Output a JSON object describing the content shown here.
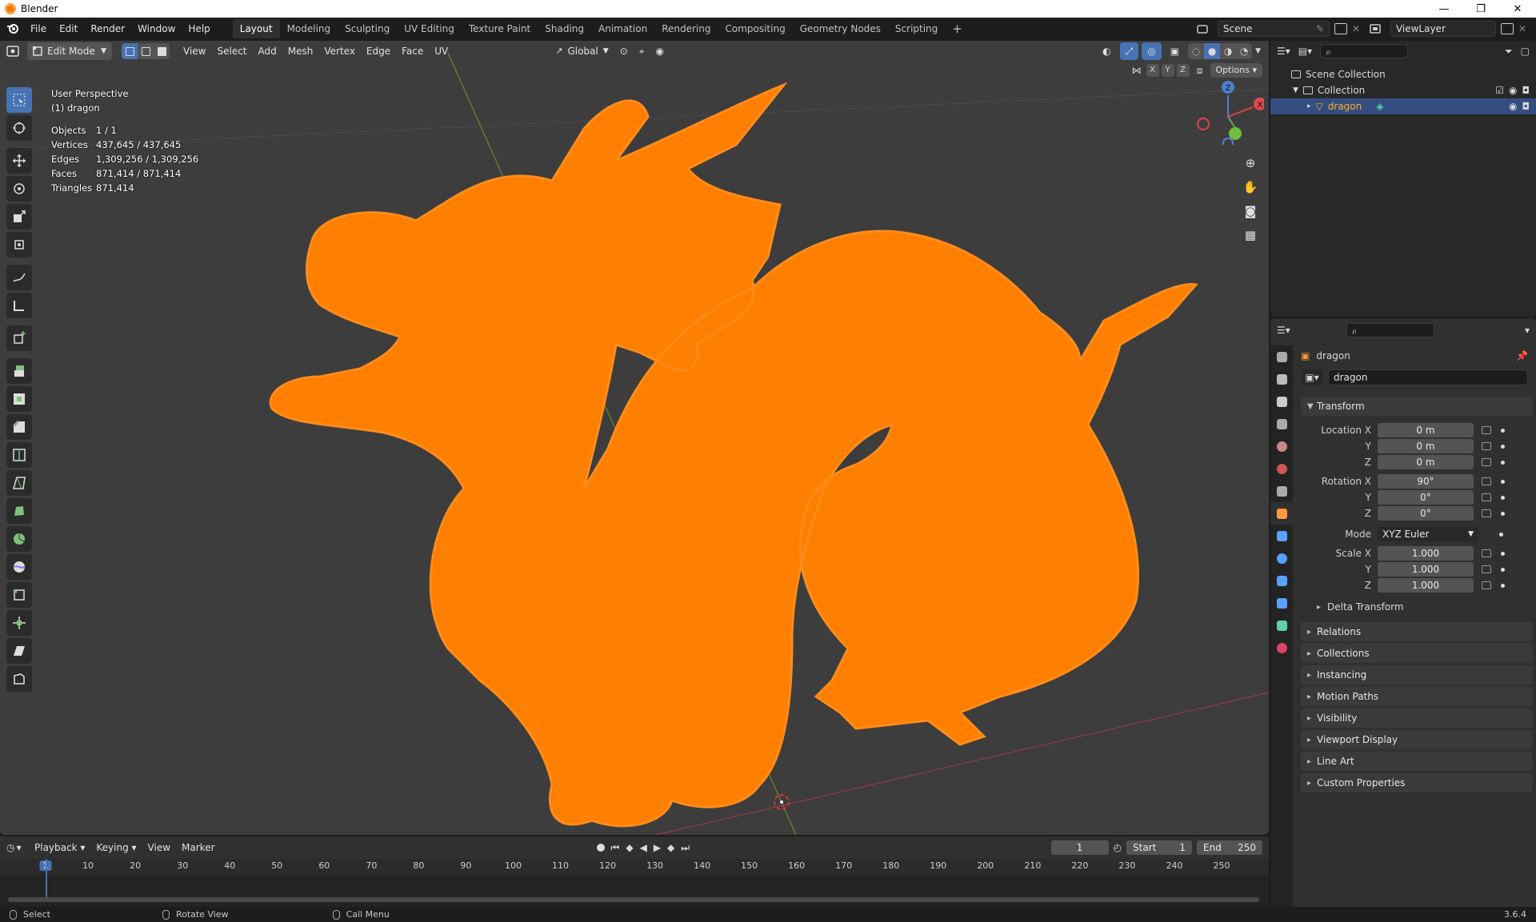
{
  "window": {
    "title": "Blender",
    "minimize": "—",
    "maximize": "❐",
    "close": "✕"
  },
  "menus": [
    "File",
    "Edit",
    "Render",
    "Window",
    "Help"
  ],
  "workspaces": [
    {
      "label": "Layout",
      "active": true
    },
    {
      "label": "Modeling"
    },
    {
      "label": "Sculpting"
    },
    {
      "label": "UV Editing"
    },
    {
      "label": "Texture Paint"
    },
    {
      "label": "Shading"
    },
    {
      "label": "Animation"
    },
    {
      "label": "Rendering"
    },
    {
      "label": "Compositing"
    },
    {
      "label": "Geometry Nodes"
    },
    {
      "label": "Scripting"
    }
  ],
  "add_workspace": "+",
  "scene": {
    "name": "Scene",
    "view_layer": "ViewLayer"
  },
  "viewport_header": {
    "mode": "Edit Mode",
    "menus": [
      "View",
      "Select",
      "Add",
      "Mesh",
      "Vertex",
      "Edge",
      "Face",
      "UV"
    ],
    "orientation": "Global",
    "axes": [
      "X",
      "Y",
      "Z"
    ],
    "options": "Options"
  },
  "overlay": {
    "view_name": "User Perspective",
    "object_label": "(1) dragon",
    "stats": [
      {
        "key": "Objects",
        "value": "1 / 1"
      },
      {
        "key": "Vertices",
        "value": "437,645 / 437,645"
      },
      {
        "key": "Edges",
        "value": "1,309,256 / 1,309,256"
      },
      {
        "key": "Faces",
        "value": "871,414 / 871,414"
      },
      {
        "key": "Triangles",
        "value": "871,414"
      }
    ]
  },
  "gizmo": {
    "z": "Z",
    "y": "Y",
    "x": "X"
  },
  "outliner": {
    "root": "Scene Collection",
    "collection": "Collection",
    "object": "dragon"
  },
  "properties": {
    "object_name": "dragon",
    "data_name": "dragon",
    "transform_title": "Transform",
    "location": [
      {
        "label": "Location X",
        "value": "0 m"
      },
      {
        "label": "Y",
        "value": "0 m"
      },
      {
        "label": "Z",
        "value": "0 m"
      }
    ],
    "rotation": [
      {
        "label": "Rotation X",
        "value": "90°"
      },
      {
        "label": "Y",
        "value": "0°"
      },
      {
        "label": "Z",
        "value": "0°"
      }
    ],
    "mode_label": "Mode",
    "mode_value": "XYZ Euler",
    "scale": [
      {
        "label": "Scale X",
        "value": "1.000"
      },
      {
        "label": "Y",
        "value": "1.000"
      },
      {
        "label": "Z",
        "value": "1.000"
      }
    ],
    "delta_transform": "Delta Transform",
    "panels": [
      "Relations",
      "Collections",
      "Instancing",
      "Motion Paths",
      "Visibility",
      "Viewport Display",
      "Line Art",
      "Custom Properties"
    ]
  },
  "timeline": {
    "menus": [
      "Playback",
      "Keying",
      "View",
      "Marker"
    ],
    "current_frame": "1",
    "start_label": "Start",
    "start": "1",
    "end_label": "End",
    "end": "250",
    "ticks": [
      "1",
      "10",
      "20",
      "30",
      "40",
      "50",
      "60",
      "70",
      "80",
      "90",
      "100",
      "110",
      "120",
      "130",
      "140",
      "150",
      "160",
      "170",
      "180",
      "190",
      "200",
      "210",
      "220",
      "230",
      "240",
      "250"
    ]
  },
  "statusbar": {
    "select": "Select",
    "rotate": "Rotate View",
    "call_menu": "Call Menu",
    "version": "3.6.4"
  },
  "colors": {
    "accent": "#4772b3",
    "selection": "#ff7f00",
    "header": "#303030"
  }
}
